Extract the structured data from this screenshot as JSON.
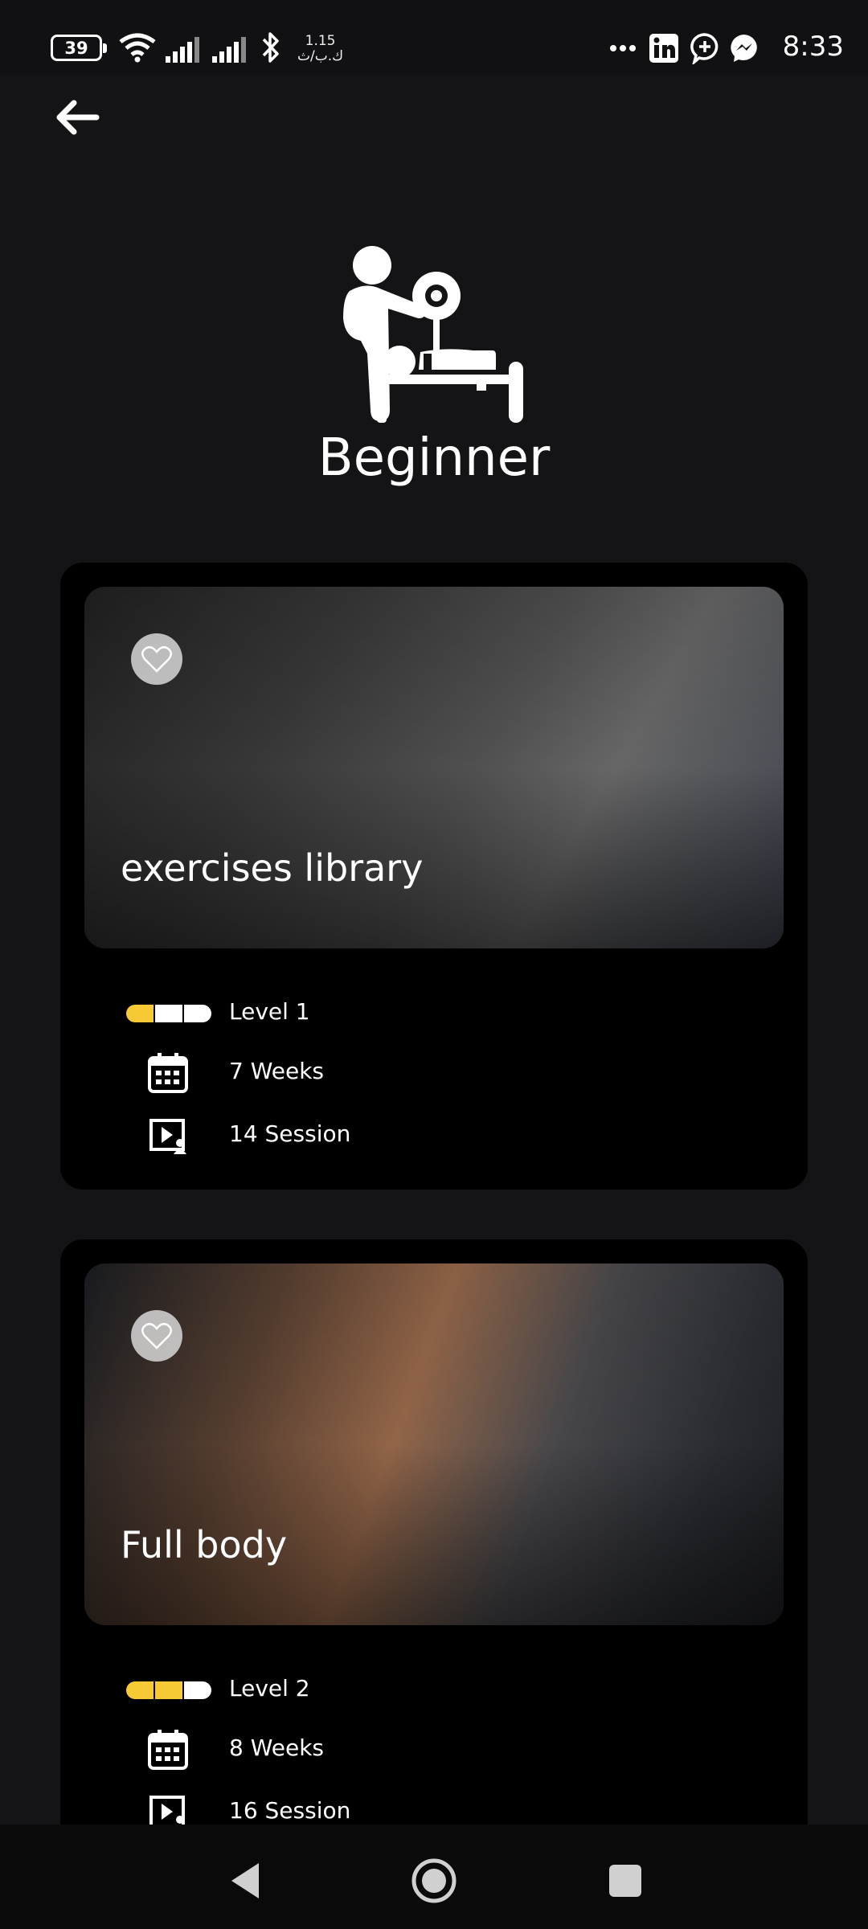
{
  "status_bar": {
    "battery": "39",
    "speed_value": "1.15",
    "speed_unit": "ك.ب/ث",
    "time": "8:33",
    "icons": [
      "wifi-icon",
      "signal-icon",
      "signal-icon",
      "bluetooth-icon",
      "more-icon",
      "linkedin-icon",
      "chat-plus-icon",
      "messenger-icon"
    ]
  },
  "header": {
    "title": "Beginner",
    "icon": "trainer-bench-icon"
  },
  "programs": [
    {
      "title": "exercises library",
      "level": "Level 1",
      "level_value": 1,
      "level_max": 3,
      "duration": "7 Weeks",
      "sessions": "14 Session",
      "image": "bench-press-photo"
    },
    {
      "title": "Full body",
      "level": "Level 2",
      "level_value": 2,
      "level_max": 3,
      "duration": "8 Weeks",
      "sessions": "16 Session",
      "image": "push-up-photo"
    }
  ],
  "colors": {
    "background": "#141416",
    "card": "#000000",
    "accent": "#f7ca35"
  },
  "nav": {
    "buttons": [
      "back-triangle-icon",
      "home-circle-icon",
      "recents-square-icon"
    ]
  }
}
